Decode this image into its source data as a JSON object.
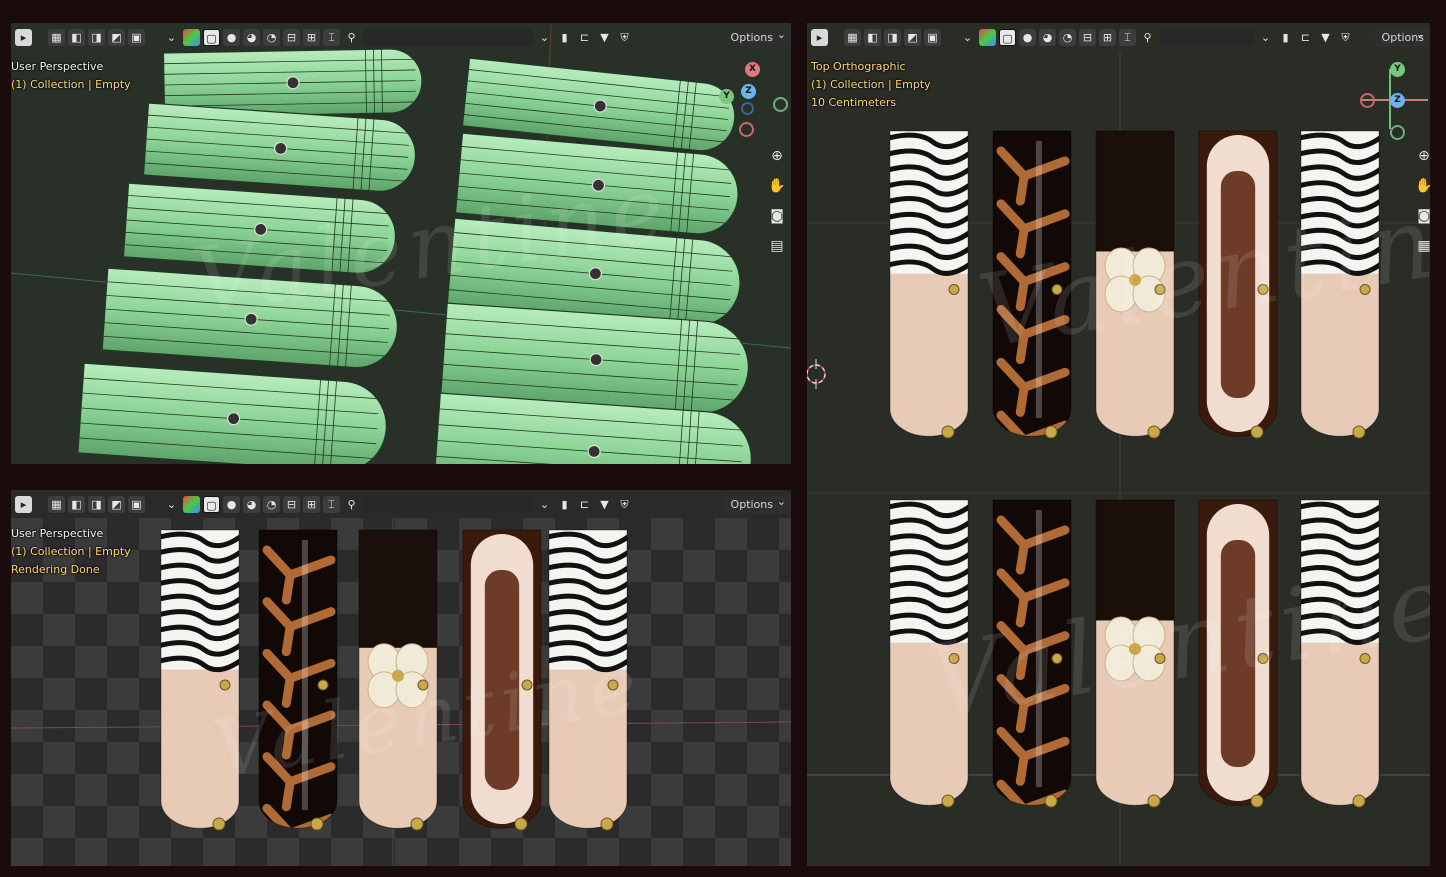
{
  "viewports": {
    "top_left": {
      "view_name": "User Perspective",
      "collection": "(1) Collection | Empty",
      "options_label": "Options",
      "watermark": "Valentine"
    },
    "bottom_left": {
      "view_name": "User Perspective",
      "collection": "(1) Collection | Empty",
      "status": "Rendering Done",
      "options_label": "Options",
      "watermark": "Valentine"
    },
    "right": {
      "view_name": "Top Orthographic",
      "collection": "(1) Collection | Empty",
      "scale": "10 Centimeters",
      "options_label": "Options",
      "watermark": "Valentine"
    }
  },
  "gizmo": {
    "x_label": "X",
    "y_label": "Y",
    "z_label": "Z"
  },
  "colors": {
    "axis_x": "#e06b6b",
    "axis_y": "#6bc46b",
    "axis_z": "#5aa8e6",
    "nail_nude": "#e8cbb7",
    "nail_brown": "#3a1a0c",
    "mesh_green": "#8fd49b",
    "gold": "#c9a84a"
  },
  "icons": {
    "header": [
      "select-box-icon",
      "mode-icon",
      "xray-icon",
      "shading-solid-icon",
      "shading-material-icon",
      "shading-rendered-icon",
      "overlay-icon",
      "gizmo-icon",
      "search-icon",
      "bookmark-icon",
      "filter-icon",
      "shield-icon"
    ],
    "nav": [
      "zoom-icon",
      "hand-pan-icon",
      "camera-icon",
      "grid-icon"
    ]
  },
  "nail_designs": [
    "zebra",
    "giraffe",
    "flower",
    "cat-eye",
    "zebra"
  ]
}
